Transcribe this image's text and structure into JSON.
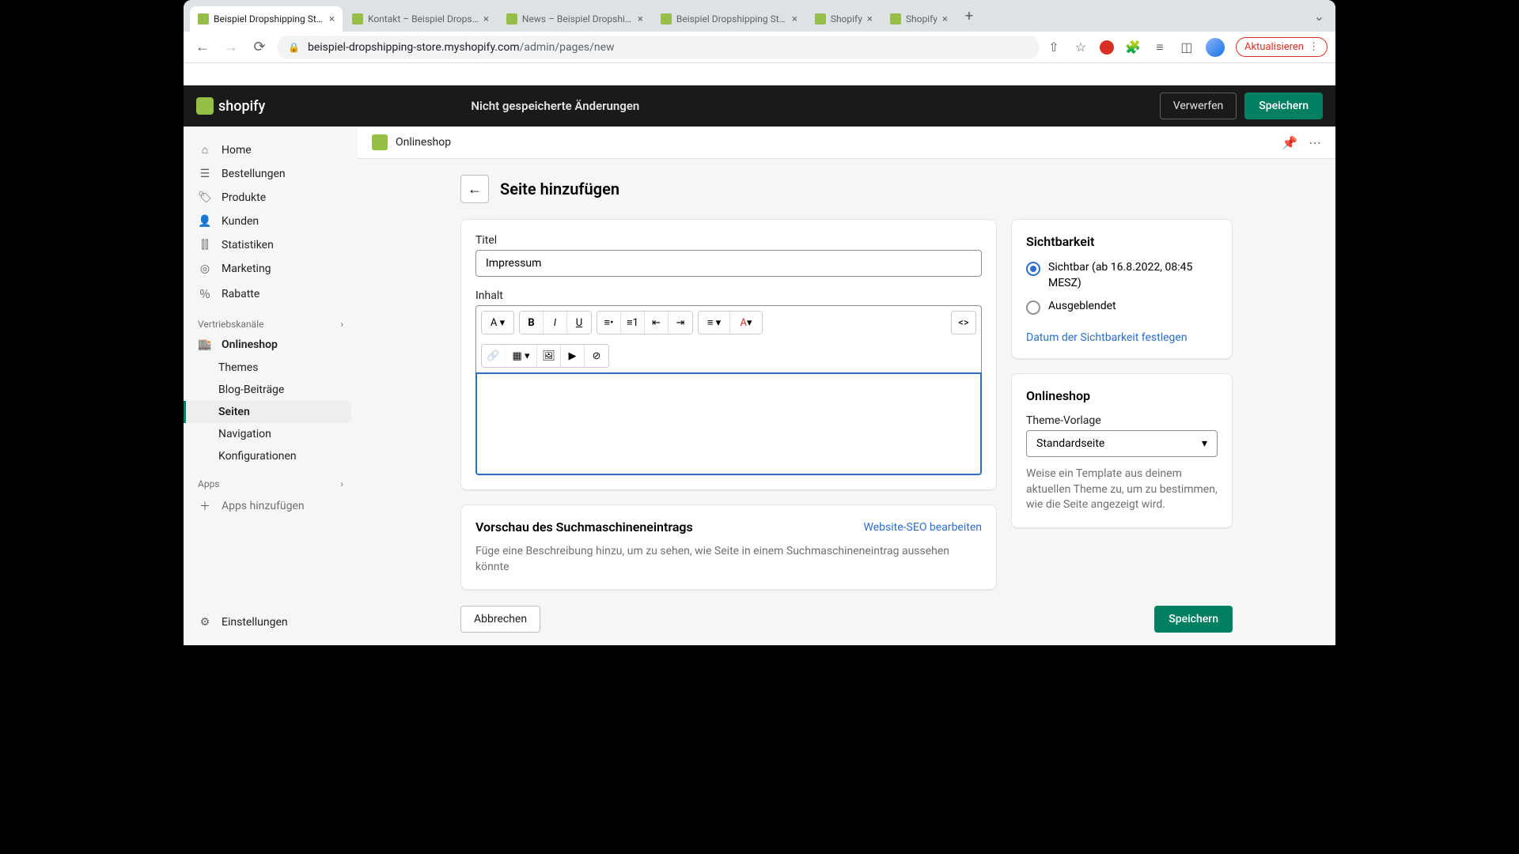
{
  "browser": {
    "tabs": [
      {
        "title": "Beispiel Dropshipping Store",
        "active": true
      },
      {
        "title": "Kontakt – Beispiel Dropship",
        "active": false
      },
      {
        "title": "News – Beispiel Dropshipp",
        "active": false
      },
      {
        "title": "Beispiel Dropshipping Store",
        "active": false
      },
      {
        "title": "Shopify",
        "active": false
      },
      {
        "title": "Shopify",
        "active": false
      }
    ],
    "url_host": "beispiel-dropshipping-store.myshopify.com",
    "url_path": "/admin/pages/new",
    "update_label": "Aktualisieren"
  },
  "appbar": {
    "logo_text": "shopify",
    "unsaved_label": "Nicht gespeicherte Änderungen",
    "discard_label": "Verwerfen",
    "save_label": "Speichern"
  },
  "sidebar": {
    "items": [
      {
        "label": "Home",
        "icon": "⌂"
      },
      {
        "label": "Bestellungen",
        "icon": "📋"
      },
      {
        "label": "Produkte",
        "icon": "🏷"
      },
      {
        "label": "Kunden",
        "icon": "👤"
      },
      {
        "label": "Statistiken",
        "icon": "📊"
      },
      {
        "label": "Marketing",
        "icon": "🎯"
      },
      {
        "label": "Rabatte",
        "icon": "％"
      }
    ],
    "channels_label": "Vertriebskanäle",
    "onlineshop_label": "Onlineshop",
    "onlineshop_sub": [
      {
        "label": "Themes"
      },
      {
        "label": "Blog-Beiträge"
      },
      {
        "label": "Seiten",
        "active": true
      },
      {
        "label": "Navigation"
      },
      {
        "label": "Konfigurationen"
      }
    ],
    "apps_label": "Apps",
    "add_apps_label": "Apps hinzufügen",
    "settings_label": "Einstellungen"
  },
  "breadcrumb": {
    "label": "Onlineshop"
  },
  "page": {
    "title": "Seite hinzufügen",
    "form": {
      "title_label": "Titel",
      "title_value": "Impressum",
      "content_label": "Inhalt"
    },
    "seo": {
      "heading": "Vorschau des Suchmaschineneintrags",
      "edit_link": "Website-SEO bearbeiten",
      "description": "Füge eine Beschreibung hinzu, um zu sehen, wie Seite in einem Suchmaschineneintrag aussehen könnte"
    }
  },
  "visibility": {
    "heading": "Sichtbarkeit",
    "visible_label": "Sichtbar (ab 16.8.2022, 08:45 MESZ)",
    "hidden_label": "Ausgeblendet",
    "set_date_link": "Datum der Sichtbarkeit festlegen"
  },
  "template": {
    "heading": "Onlineshop",
    "label": "Theme-Vorlage",
    "selected": "Standardseite",
    "helper": "Weise ein Template aus deinem aktuellen Theme zu, um zu bestimmen, wie die Seite angezeigt wird."
  },
  "footer": {
    "cancel_label": "Abbrechen",
    "save_label": "Speichern"
  }
}
